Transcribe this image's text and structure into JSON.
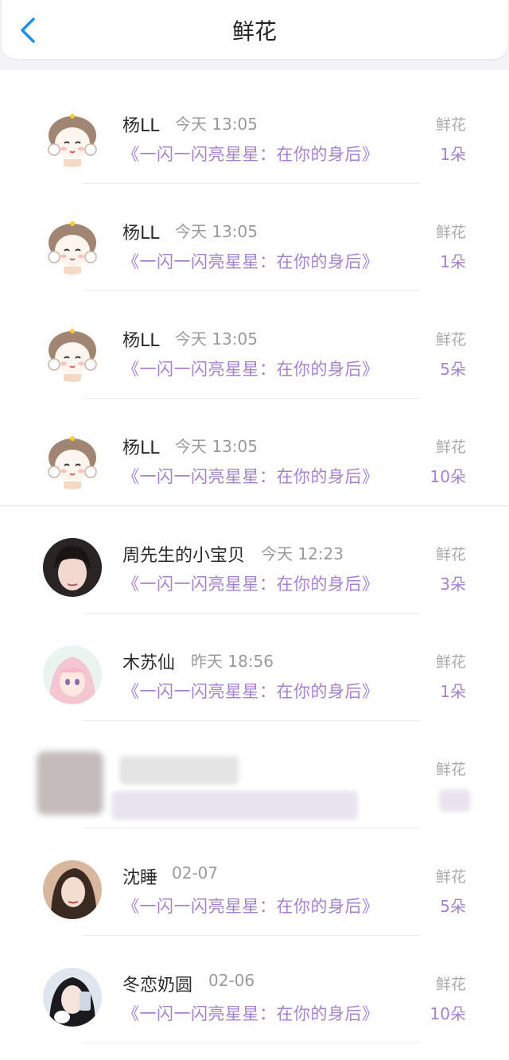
{
  "header": {
    "title": "鲜花",
    "back_icon": "chevron-left-icon",
    "accent_color": "#1e8fe8"
  },
  "colors": {
    "book_title": "#a582cc",
    "count": "#a582cc",
    "time": "#9a9a9a",
    "label": "#aaaaaa"
  },
  "records": [
    {
      "name": "杨LL",
      "time": "今天 13:05",
      "book": "《一闪一闪亮星星：在你的身后》",
      "gift": "鲜花",
      "count": "1朵",
      "avatar": "cartoon-girl-avatar"
    },
    {
      "name": "杨LL",
      "time": "今天 13:05",
      "book": "《一闪一闪亮星星：在你的身后》",
      "gift": "鲜花",
      "count": "1朵",
      "avatar": "cartoon-girl-avatar"
    },
    {
      "name": "杨LL",
      "time": "今天 13:05",
      "book": "《一闪一闪亮星星：在你的身后》",
      "gift": "鲜花",
      "count": "5朵",
      "avatar": "cartoon-girl-avatar"
    },
    {
      "name": "杨LL",
      "time": "今天 13:05",
      "book": "《一闪一闪亮星星：在你的身后》",
      "gift": "鲜花",
      "count": "10朵",
      "avatar": "cartoon-girl-avatar"
    },
    {
      "name": "周先生的小宝贝",
      "time": "今天 12:23",
      "book": "《一闪一闪亮星星：在你的身后》",
      "gift": "鲜花",
      "count": "3朵",
      "avatar": "photo-avatar"
    },
    {
      "name": "木苏仙",
      "time": "昨天 18:56",
      "book": "《一闪一闪亮星星：在你的身后》",
      "gift": "鲜花",
      "count": "1朵",
      "avatar": "anime-avatar"
    },
    {
      "name": "",
      "time": "",
      "book": "",
      "gift": "鲜花",
      "count": "",
      "avatar": "blurred-avatar"
    },
    {
      "name": "沈睡",
      "time": "02-07",
      "book": "《一闪一闪亮星星：在你的身后》",
      "gift": "鲜花",
      "count": "5朵",
      "avatar": "photo-avatar"
    },
    {
      "name": "冬恋奶圆",
      "time": "02-06",
      "book": "《一闪一闪亮星星：在你的身后》",
      "gift": "鲜花",
      "count": "10朵",
      "avatar": "photo-avatar"
    }
  ]
}
